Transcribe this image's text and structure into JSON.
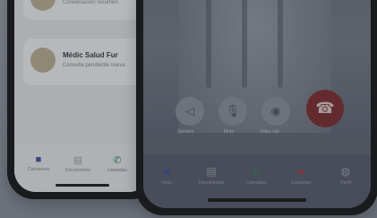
{
  "left_phone": {
    "chats": [
      {
        "name": "",
        "subtitle": "Conversación resumen"
      },
      {
        "name": "Médic Salud Fur",
        "subtitle": "Consulta pendiente nueva"
      }
    ],
    "tabs": [
      {
        "label": "Conversas",
        "icon": "chat-icon"
      },
      {
        "label": "Documentos",
        "icon": "document-icon"
      },
      {
        "label": "Llamadas",
        "icon": "phone-icon"
      }
    ]
  },
  "right_phone": {
    "controls": [
      {
        "label": "Speaker",
        "icon": "speaker-icon",
        "glyph": "◁"
      },
      {
        "label": "Mute",
        "icon": "microphone-icon",
        "glyph": "🎙"
      },
      {
        "label": "Video call",
        "icon": "video-icon",
        "glyph": "◉"
      }
    ],
    "end_call": {
      "icon": "end-call-icon",
      "glyph": "☎"
    },
    "tabs": [
      {
        "label": "Inicio",
        "icon": "home-icon"
      },
      {
        "label": "Documentos",
        "icon": "document-icon"
      },
      {
        "label": "Llamadas",
        "icon": "phone-icon"
      },
      {
        "label": "Consultas",
        "icon": "chat-icon"
      },
      {
        "label": "Perfil",
        "icon": "profile-icon"
      }
    ]
  },
  "colors": {
    "accent_blue": "#3d4f9c",
    "accent_green": "#2f8a5c",
    "accent_red": "#b0362f",
    "end_call": "#7c2b2f"
  }
}
